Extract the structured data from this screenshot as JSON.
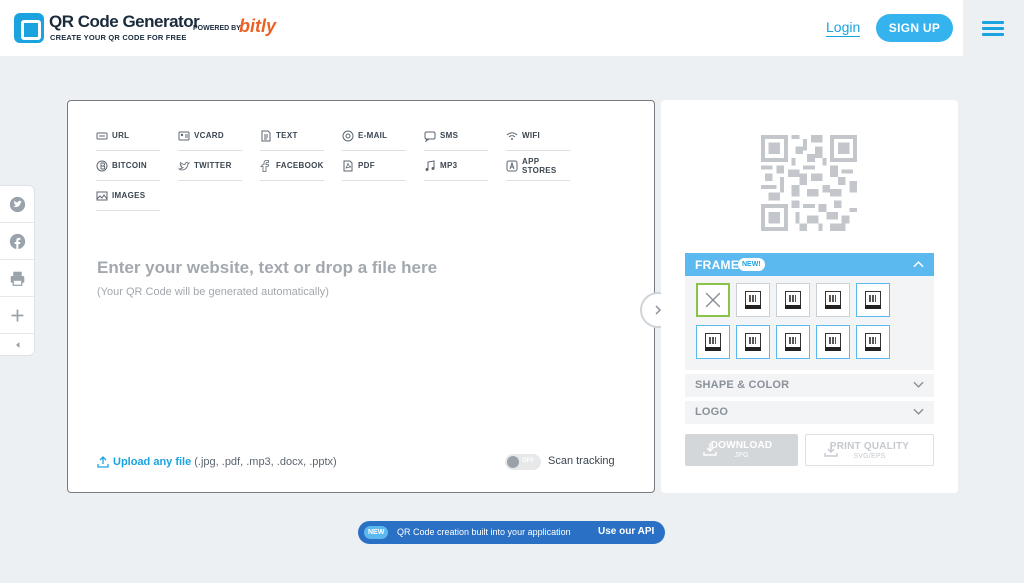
{
  "header": {
    "title": "QR Code Generator",
    "subtitle": "CREATE YOUR QR CODE FOR FREE",
    "powered_by": "POWERED BY",
    "brand": "bitly",
    "login": "Login",
    "signup": "SIGN UP"
  },
  "side_share": [
    "twitter-icon",
    "facebook-icon",
    "print-icon",
    "plus-icon",
    "collapse-icon"
  ],
  "tabs": [
    {
      "label": "URL",
      "icon": "url-icon"
    },
    {
      "label": "VCARD",
      "icon": "vcard-icon"
    },
    {
      "label": "TEXT",
      "icon": "text-icon"
    },
    {
      "label": "E-MAIL",
      "icon": "email-icon"
    },
    {
      "label": "SMS",
      "icon": "sms-icon"
    },
    {
      "label": "WIFI",
      "icon": "wifi-icon"
    },
    {
      "label": "BITCOIN",
      "icon": "bitcoin-icon"
    },
    {
      "label": "TWITTER",
      "icon": "twitter-icon"
    },
    {
      "label": "FACEBOOK",
      "icon": "facebook-icon"
    },
    {
      "label": "PDF",
      "icon": "pdf-icon"
    },
    {
      "label": "MP3",
      "icon": "mp3-icon"
    },
    {
      "label": "APP STORES",
      "icon": "appstore-icon"
    },
    {
      "label": "IMAGES",
      "icon": "images-icon"
    }
  ],
  "editor": {
    "prompt": "Enter your website, text or drop a file here",
    "prompt_sub": "(Your QR Code will be generated automatically)",
    "upload_link": "Upload any file",
    "upload_types": "(.jpg, .pdf, .mp3, .docx, .pptx)",
    "toggle_state": "OFF",
    "scan_tracking": "Scan tracking"
  },
  "customize": {
    "frame_title": "FRAME",
    "frame_badge": "NEW!",
    "shape_color": "SHAPE & COLOR",
    "logo": "LOGO",
    "download_label": "DOWNLOAD",
    "download_sub": "JPG",
    "print_label": "PRINT QUALITY",
    "print_sub": "SVG/EPS"
  },
  "banner": {
    "badge": "NEW",
    "text": "QR Code creation built into your application",
    "link": "Use our API"
  },
  "colors": {
    "accent": "#1ba3e0",
    "signup_bg": "#35b3ee",
    "frame_header": "#5cb9f0",
    "banner_bg": "#2a70c4",
    "brand_orange": "#ee6123"
  }
}
